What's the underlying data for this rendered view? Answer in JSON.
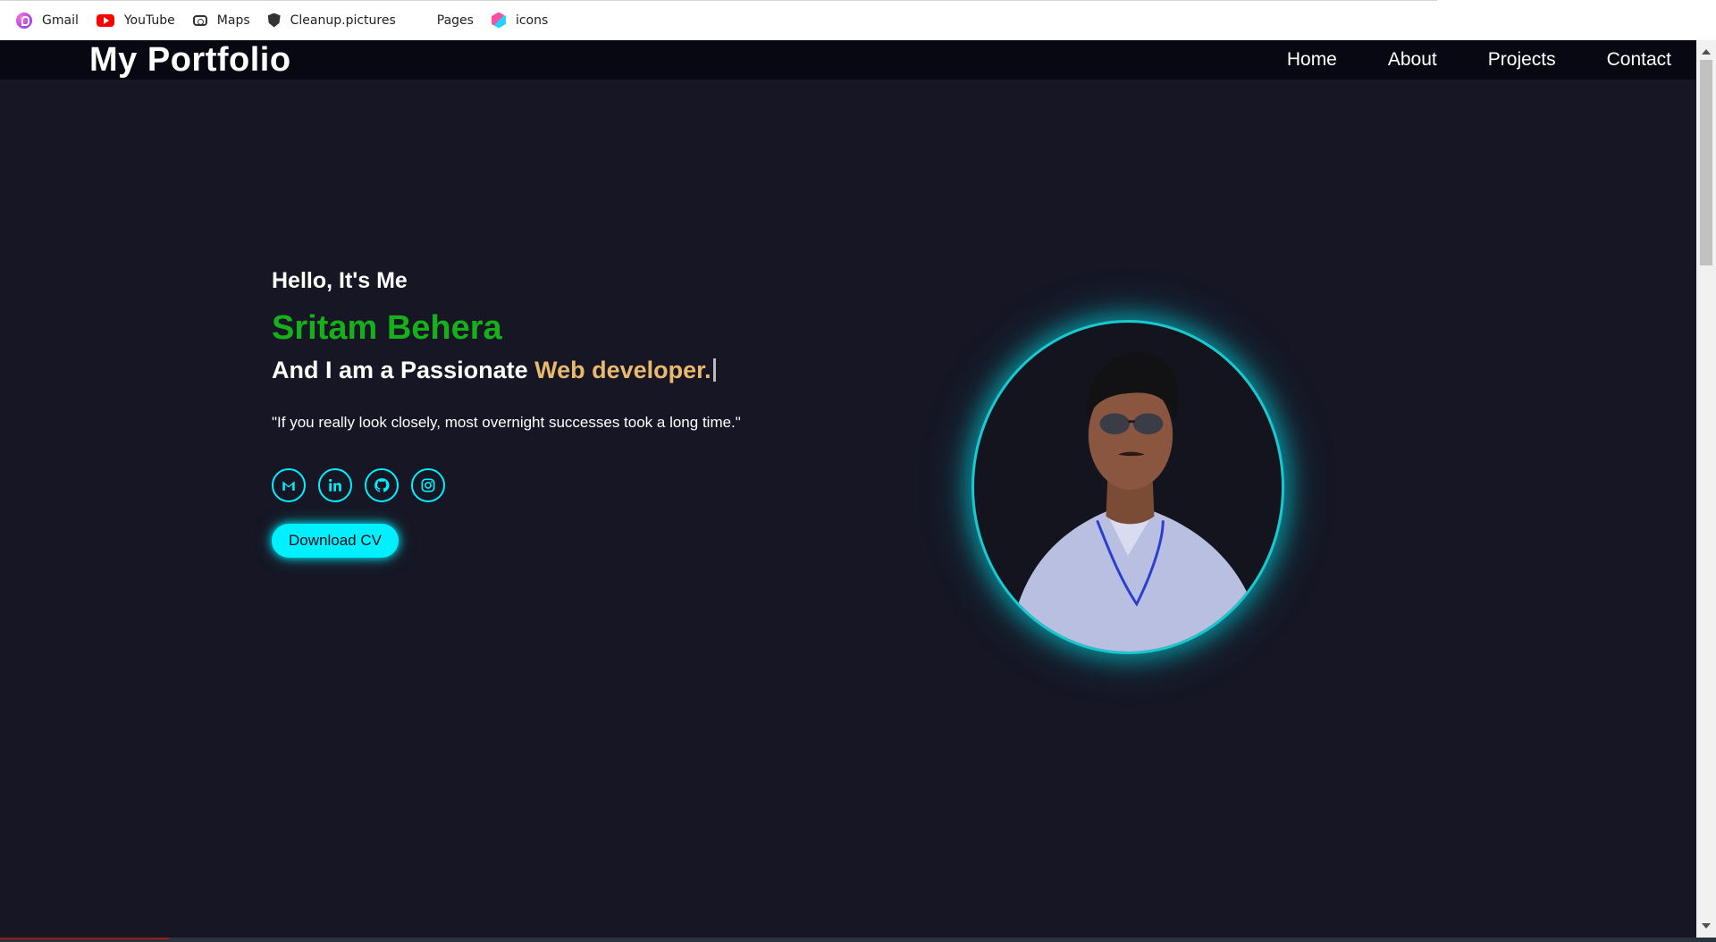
{
  "bookmarks": [
    {
      "label": "Gmail",
      "icon": "gmail-profile-icon"
    },
    {
      "label": "YouTube",
      "icon": "youtube-icon"
    },
    {
      "label": "Maps",
      "icon": "maps-icon"
    },
    {
      "label": "Cleanup.pictures",
      "icon": "shield-icon"
    },
    {
      "label": "Pages",
      "icon": ""
    },
    {
      "label": "icons",
      "icon": "cube-icon"
    }
  ],
  "navbar": {
    "logo": "My Portfolio",
    "links": [
      "Home",
      "About",
      "Projects",
      "Contact"
    ]
  },
  "hero": {
    "greeting": "Hello, It's Me",
    "name": "Sritam Behera",
    "role_prefix": "And I am a Passionate ",
    "role_typed": "Web developer.",
    "quote": "\"If you really look closely, most overnight successes took a long time.\"",
    "socials": [
      "gmail-icon",
      "linkedin-icon",
      "github-icon",
      "instagram-icon"
    ],
    "cv_button": "Download CV"
  },
  "colors": {
    "background": "#161624",
    "navbar": "#080812",
    "name": "#15b01a",
    "typed": "#e9b96e",
    "accent": "#00f0ff"
  }
}
